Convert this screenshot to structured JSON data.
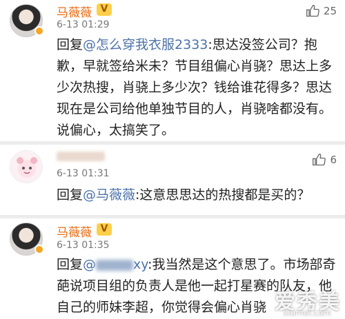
{
  "comments": [
    {
      "username": "马薇薇",
      "vip_badge": "V",
      "time": "6-13 01:29",
      "likes": "25",
      "reply_prefix": "回复",
      "mention": "@怎么穿我衣服2333",
      "text": ":思达没签公司？抱歉，早就签给米未？节目组偏心肖骁？思达上多少次热搜，肖骁上多少次？钱给谁花得多？思达现在是公司给他单独节目的人，肖骁啥都没有。说偏心，太搞笑了。"
    },
    {
      "time": "6-13 01:31",
      "likes": "6",
      "reply_prefix": "回复",
      "mention": "@马薇薇",
      "text": ":这意思思达的热搜都是买的？"
    },
    {
      "username": "马薇薇",
      "vip_badge": "V",
      "time": "6-13 01:35",
      "reply_prefix": "回复",
      "mention": "@",
      "mention_tail": "xy",
      "text": ":我当然是这个意思了。市场部奇葩说项目组的负责人是他一起打星赛的队友，他自己的师妹李超，你觉得会偏心肖骁"
    }
  ],
  "watermark": {
    "main": "爱秀美",
    "sub": "xiumei.com"
  },
  "icons": {
    "like": "thumbs-up-icon",
    "vip": "vip-badge-icon"
  }
}
